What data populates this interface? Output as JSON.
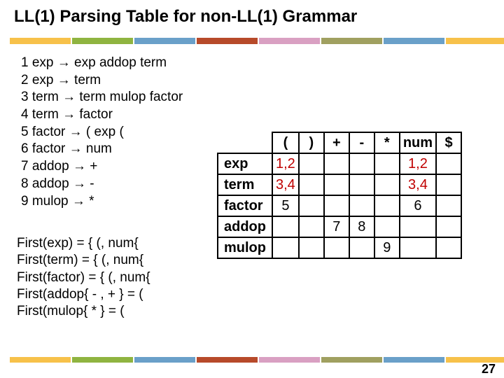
{
  "title": "LL(1) Parsing Table for non-LL(1) Grammar",
  "page_number": "27",
  "arrow_glyph": "→",
  "band_colors": [
    "#f7c14a",
    "#8fb440",
    "#6aa0c9",
    "#b74a2a",
    "#d9a0c2",
    "#a0a060",
    "#6aa0c9",
    "#f7c14a"
  ],
  "bottom_band_colors": [
    "#f7c14a",
    "#8fb440",
    "#6aa0c9",
    "#b74a2a",
    "#d9a0c2",
    "#a0a060",
    "#6aa0c9",
    "#f7c14a"
  ],
  "grammar": [
    {
      "n": "1",
      "lhs": "exp",
      "rhs": "exp addop term"
    },
    {
      "n": "2",
      "lhs": "exp",
      "rhs": "term"
    },
    {
      "n": "3",
      "lhs": "term",
      "rhs": "term mulop factor"
    },
    {
      "n": "4",
      "lhs": "term",
      "rhs": "factor"
    },
    {
      "n": "5",
      "lhs": "factor",
      "rhs": "( exp ("
    },
    {
      "n": "6",
      "lhs": "factor",
      "rhs": "num"
    },
    {
      "n": "7",
      "lhs": "addop",
      "rhs": "+"
    },
    {
      "n": "8",
      "lhs": "addop",
      "rhs": "-"
    },
    {
      "n": "9",
      "lhs": "mulop",
      "rhs": "*"
    }
  ],
  "first_sets": [
    "First(exp) = { (, num{",
    "First(term) = { (, num{",
    "First(factor) = { (, num{",
    "First(addop{ - , + } = (",
    "First(mulop{ * } = ("
  ],
  "chart_data": {
    "type": "table",
    "columns": [
      "(",
      ")",
      "+",
      "-",
      "*",
      "num",
      "$"
    ],
    "rows": [
      "exp",
      "term",
      "factor",
      "addop",
      "mulop"
    ],
    "cells": {
      "exp": {
        "(": "1,2",
        "num": "1,2"
      },
      "term": {
        "(": "3,4",
        "num": "3,4"
      },
      "factor": {
        "(": "5",
        "num": "6"
      },
      "addop": {
        "+": "7",
        "-": "8"
      },
      "mulop": {
        "*": "9"
      }
    },
    "conflict_cells": [
      "exp.(",
      "exp.num",
      "term.(",
      "term.num"
    ]
  }
}
